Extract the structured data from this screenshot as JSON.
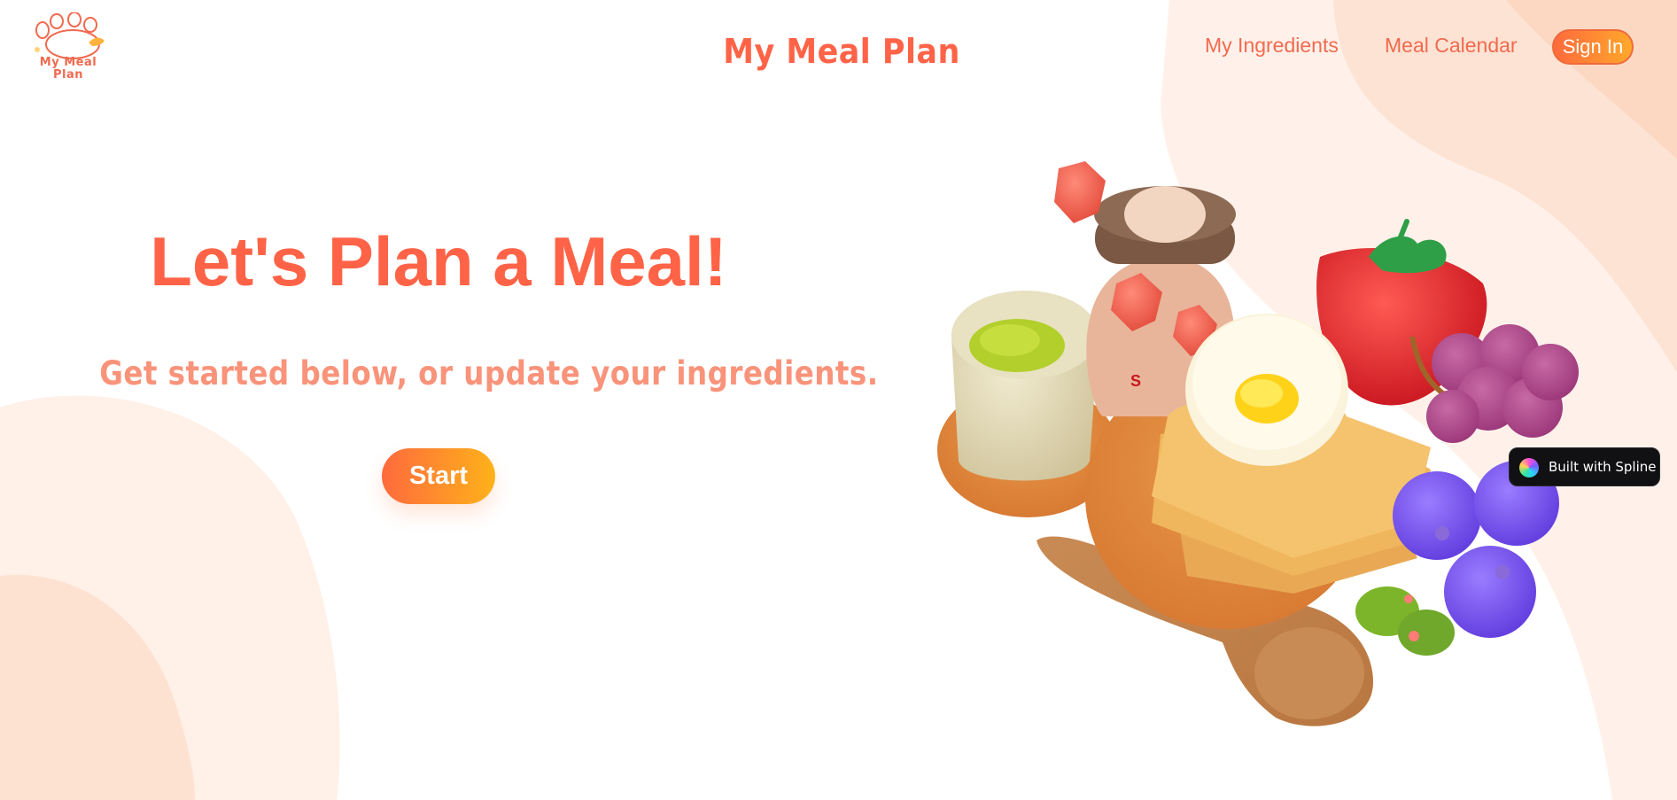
{
  "header": {
    "logo_text": "My Meal\nPlan",
    "brand": "My Meal Plan",
    "nav": [
      {
        "label": "My Ingredients"
      },
      {
        "label": "Meal Calendar"
      }
    ],
    "signin_label": "Sign In"
  },
  "hero": {
    "title": "Let's Plan a Meal!",
    "subtitle": "Get started below, or update your ingredients.",
    "start_label": "Start"
  },
  "scene": {
    "shaker_letter": "S",
    "badge_label": "Built with Spline"
  },
  "colors": {
    "accent": "#ff6347",
    "accent_light": "#f9937a",
    "gradient_start": "#ff6a3d",
    "gradient_end": "#ffb21a",
    "blob": "#fde6d9"
  }
}
